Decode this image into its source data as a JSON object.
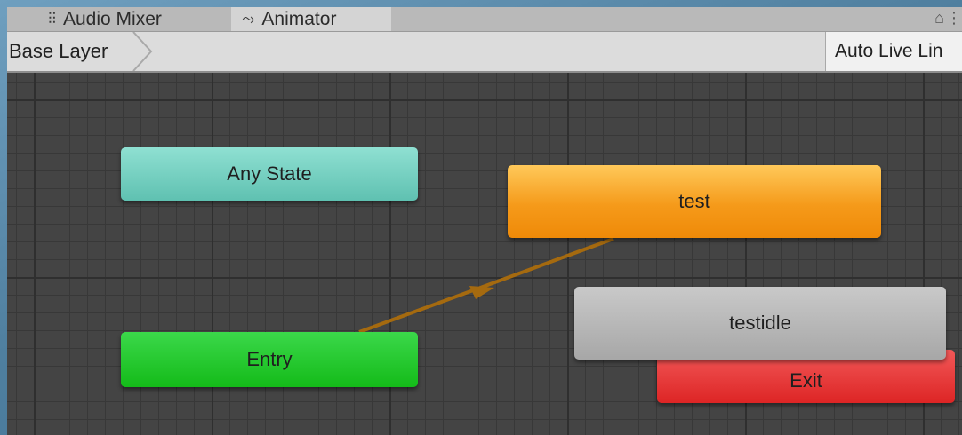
{
  "tabs": [
    {
      "label": "Audio Mixer",
      "icon": "mixer-icon",
      "active": false
    },
    {
      "label": "Animator",
      "icon": "animator-icon",
      "active": true
    }
  ],
  "breadcrumb": {
    "label": "Base Layer"
  },
  "toolbar": {
    "live_link_label": "Auto Live Lin"
  },
  "graph": {
    "nodes": {
      "any_state": {
        "label": "Any State",
        "color": "#7dd7c7"
      },
      "test": {
        "label": "test",
        "color": "#f59a1a"
      },
      "testidle": {
        "label": "testidle",
        "color": "#b3b3b3"
      },
      "entry": {
        "label": "Entry",
        "color": "#1fc426"
      },
      "exit": {
        "label": "Exit",
        "color": "#e22f2f"
      }
    },
    "transitions": [
      {
        "from": "Entry",
        "to": "test",
        "color": "#a56a0f"
      }
    ]
  }
}
